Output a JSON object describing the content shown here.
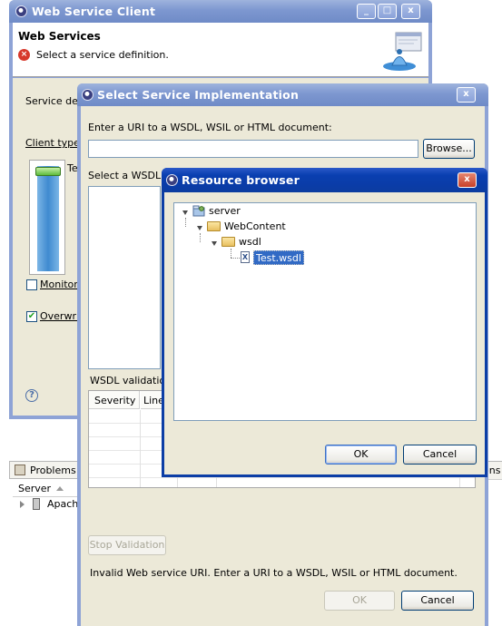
{
  "wsc": {
    "title": "Web Service Client",
    "section_title": "Web Services",
    "error_message": "Select a service definition.",
    "service_def_label": "Service def",
    "client_type_label": "Client type:",
    "client_type_value": "Te",
    "monitor_label": "Monitor",
    "overwrite_label": "Overwrit",
    "help": "?",
    "minimize": "_",
    "maximize": "□",
    "close": "x"
  },
  "ssi": {
    "title": "Select Service Implementation",
    "uri_label": "Enter a URI to a WSDL, WSIL or HTML document:",
    "uri_value": "",
    "browse_label": "Browse...",
    "select_wsdl_label": "Select a WSDL",
    "validation_label": "WSDL validation",
    "columns": [
      "Severity",
      "Line"
    ],
    "stop_validation_label": "Stop Validation",
    "status_message": "Invalid Web service URI.  Enter a URI to a WSDL, WSIL or HTML document.",
    "ok_label": "OK",
    "cancel_label": "Cancel",
    "close": "x"
  },
  "rb": {
    "title": "Resource browser",
    "tree": [
      {
        "label": "server",
        "icon": "project-icon",
        "level": 0
      },
      {
        "label": "WebContent",
        "icon": "folder-icon",
        "level": 1
      },
      {
        "label": "wsdl",
        "icon": "folder-icon",
        "level": 2
      },
      {
        "label": "Test.wsdl",
        "icon": "wsdl-file-icon",
        "level": 3,
        "selected": true
      }
    ],
    "ok_label": "OK",
    "cancel_label": "Cancel",
    "close": "x"
  },
  "bottom": {
    "problems_tab": "Problems",
    "server_column": "Server",
    "apache_item": "Apache",
    "right_tab_fragment": "ons"
  },
  "colors": {
    "selection": "#316ac5",
    "dialog_bg": "#ece9d8",
    "active_title": "#0a3fb0",
    "inactive_title": "#7d97d0"
  }
}
